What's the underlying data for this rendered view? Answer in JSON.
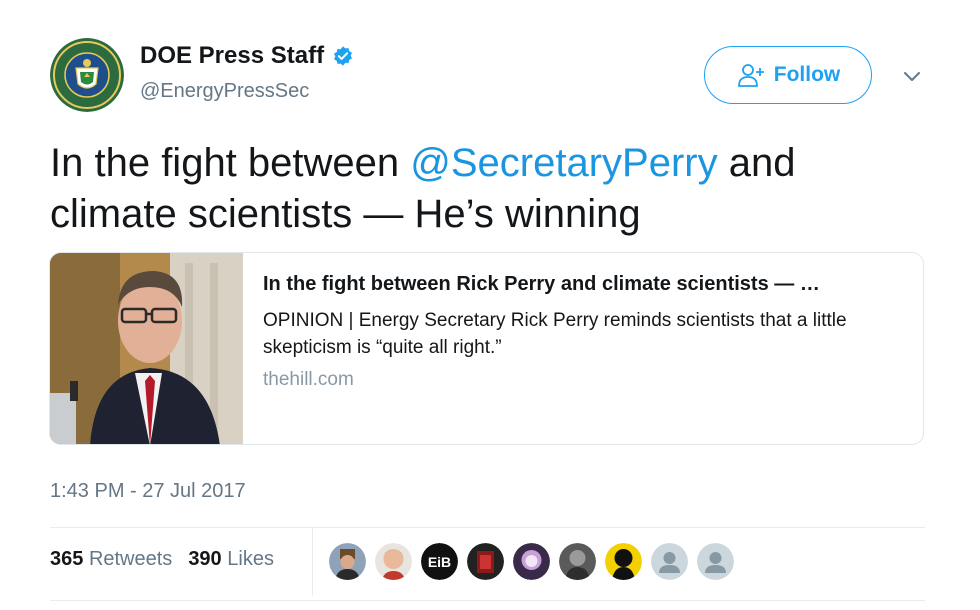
{
  "user": {
    "name": "DOE Press Staff",
    "handle": "@EnergyPressSec",
    "avatar_icon": "doe-seal-icon",
    "verified_icon": "verified-badge-icon"
  },
  "follow": {
    "label": "Follow",
    "icon": "add-user-icon",
    "accent": "#1da1f2"
  },
  "menu_icon": "chevron-down-icon",
  "tweet": {
    "text_before": "In the fight between ",
    "mention": "@SecretaryPerry",
    "text_after": " and climate scientists — He’s winning"
  },
  "card": {
    "title": "In the fight between Rick Perry and climate scientists — …",
    "description": "OPINION | Energy Secretary Rick Perry reminds scientists that a little skepticism is “quite all right.”",
    "domain": "thehill.com"
  },
  "timestamp": "1:43 PM - 27 Jul 2017",
  "stats": {
    "retweets_count": "365",
    "retweets_label": "Retweets",
    "likes_count": "390",
    "likes_label": "Likes"
  },
  "likers": [
    {
      "icon": "user-avatar-1"
    },
    {
      "icon": "user-avatar-2"
    },
    {
      "icon": "user-avatar-eib",
      "text": "EiB"
    },
    {
      "icon": "user-avatar-4"
    },
    {
      "icon": "user-avatar-5"
    },
    {
      "icon": "user-avatar-6"
    },
    {
      "icon": "user-avatar-7"
    },
    {
      "icon": "default-avatar-icon"
    },
    {
      "icon": "default-avatar-icon"
    }
  ]
}
